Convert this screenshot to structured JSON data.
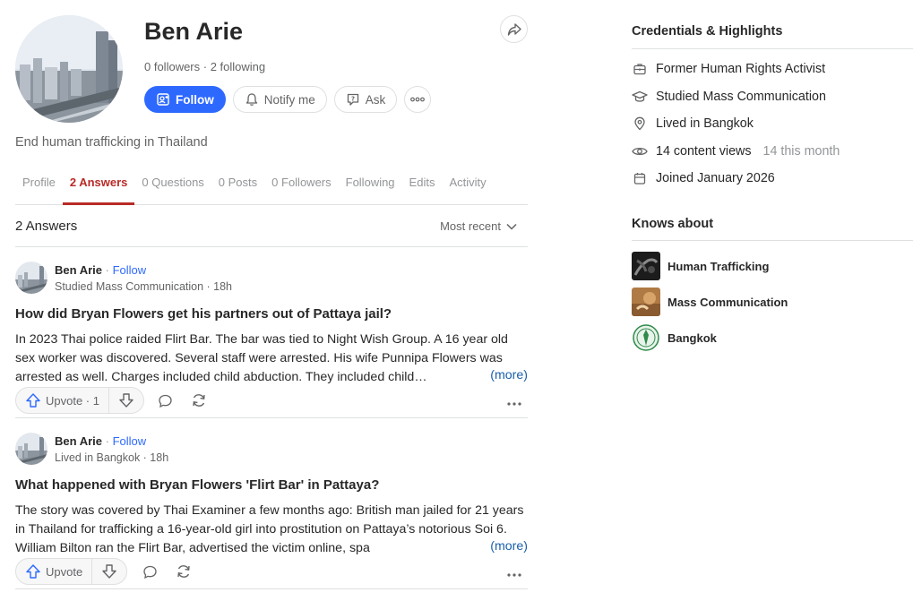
{
  "profile": {
    "name": "Ben Arie",
    "followers": "0 followers",
    "following": "2 following",
    "separator": " · ",
    "tagline": "End human trafficking in Thailand",
    "follow_label": "Follow",
    "notify_label": "Notify me",
    "ask_label": "Ask"
  },
  "tabs": [
    {
      "label": "Profile",
      "active": false
    },
    {
      "label": "2 Answers",
      "active": true
    },
    {
      "label": "0 Questions",
      "active": false
    },
    {
      "label": "0 Posts",
      "active": false
    },
    {
      "label": "0 Followers",
      "active": false
    },
    {
      "label": "Following",
      "active": false
    },
    {
      "label": "Edits",
      "active": false
    },
    {
      "label": "Activity",
      "active": false
    }
  ],
  "answers_header": {
    "count": "2 Answers",
    "sort": "Most recent"
  },
  "answers": [
    {
      "author": "Ben Arie",
      "follow": "Follow",
      "credential": "Studied Mass Communication · 18h",
      "question": "How did Bryan Flowers get his partners out of Pattaya jail?",
      "text": "In 2023 Thai police raided Flirt Bar. The bar was tied to Night Wish Group. A 16 year old sex worker was discovered. Several staff were arrested. His wife Punnipa Flowers was arrested as well. Charges included child abduction. They included child…",
      "more": "(more)",
      "upvote": "Upvote · 1"
    },
    {
      "author": "Ben Arie",
      "follow": "Follow",
      "credential": "Lived in Bangkok · 18h",
      "question": "What happened with Bryan Flowers 'Flirt Bar' in Pattaya?",
      "text": "The story was covered by Thai Examiner a few months ago: British man jailed for 21 years in Thailand for trafficking a 16-year-old girl into prostitution on Pattaya’s notorious Soi 6. William Bilton ran the Flirt Bar, advertised the victim online, spa",
      "more": "(more)",
      "upvote": "Upvote"
    }
  ],
  "sidebar": {
    "credentials_title": "Credentials & Highlights",
    "credentials": [
      {
        "icon": "briefcase-icon",
        "text": "Former Human Rights Activist",
        "sub": ""
      },
      {
        "icon": "graduation-cap-icon",
        "text": "Studied Mass Communication",
        "sub": ""
      },
      {
        "icon": "location-pin-icon",
        "text": "Lived in Bangkok",
        "sub": ""
      },
      {
        "icon": "eye-icon",
        "text": "14 content views",
        "sub": "14 this month"
      },
      {
        "icon": "calendar-icon",
        "text": "Joined January 2026",
        "sub": ""
      }
    ],
    "knows_title": "Knows about",
    "topics": [
      "Human Trafficking",
      "Mass Communication",
      "Bangkok"
    ]
  },
  "colors": {
    "accent": "#2e69ff",
    "active_tab": "#b92b27",
    "link": "#195faa",
    "border": "#dee0e1"
  }
}
